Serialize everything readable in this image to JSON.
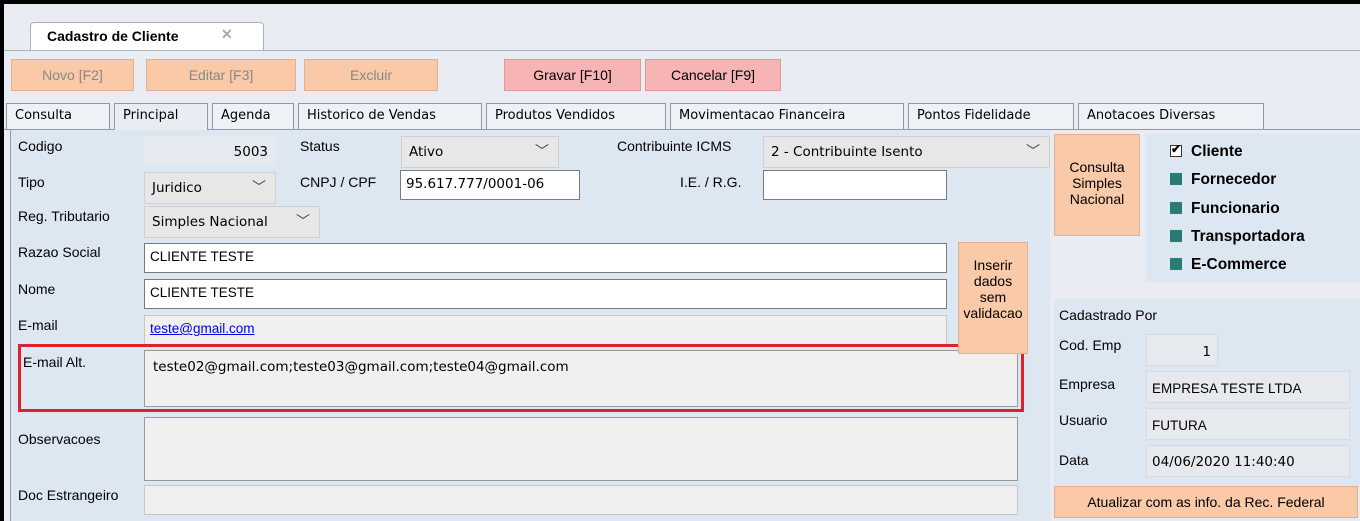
{
  "window_tab": {
    "title": "Cadastro de Cliente",
    "close": "✕"
  },
  "toolbar": {
    "novo": "Novo [F2]",
    "editar": "Editar [F3]",
    "excluir": "Excluir",
    "gravar": "Gravar [F10]",
    "cancelar": "Cancelar [F9]"
  },
  "tabs": [
    "Consulta",
    "Principal",
    "Agenda",
    "Historico de Vendas",
    "Produtos Vendidos",
    "Movimentacao Financeira",
    "Pontos Fidelidade",
    "Anotacoes Diversas"
  ],
  "selected_tab": "Principal",
  "form": {
    "codigo_label": "Codigo",
    "codigo": "5003",
    "status_label": "Status",
    "status": "Ativo",
    "contrib_label": "Contribuinte ICMS",
    "contrib": "2 - Contribuinte Isento",
    "tipo_label": "Tipo",
    "tipo": "Juridico",
    "cnpj_label": "CNPJ / CPF",
    "cnpj": "95.617.777/0001-06",
    "ie_label": "I.E. / R.G.",
    "ie": "",
    "reg_label": "Reg. Tributario",
    "reg": "Simples Nacional",
    "razao_label": "Razao Social",
    "razao": "CLIENTE TESTE",
    "nome_label": "Nome",
    "nome": "CLIENTE TESTE",
    "email_label": "E-mail",
    "email": "teste@gmail.com",
    "email_alt_label": "E-mail Alt.",
    "email_alt": "teste02@gmail.com;teste03@gmail.com;teste04@gmail.com",
    "obs_label": "Observacoes",
    "obs": "",
    "doc_label": "Doc Estrangeiro",
    "doc": ""
  },
  "buttons": {
    "consulta_simples": [
      "Consulta",
      "Simples",
      "Nacional"
    ],
    "inserir": [
      "Inserir",
      "dados",
      "sem",
      "validacao"
    ],
    "atualizar": "Atualizar com as info. da Rec. Federal"
  },
  "roles": [
    {
      "label": "Cliente",
      "checked": true
    },
    {
      "label": "Fornecedor",
      "checked": false
    },
    {
      "label": "Funcionario",
      "checked": false
    },
    {
      "label": "Transportadora",
      "checked": false
    },
    {
      "label": "E-Commerce",
      "checked": false
    }
  ],
  "cadastro": {
    "title": "Cadastrado Por",
    "cod_emp_label": "Cod. Emp",
    "cod_emp": "1",
    "empresa_label": "Empresa",
    "empresa": "EMPRESA TESTE LTDA",
    "usuario_label": "Usuario",
    "usuario": "FUTURA",
    "data_label": "Data",
    "data": "04/06/2020 11:40:40"
  },
  "colors": {
    "button_orange": "#f9c9a8",
    "button_pink": "#f7b4b4",
    "highlight_red": "#e0202a",
    "checkbox_teal": "#2a7b76",
    "panel_blue": "#dde7f2"
  }
}
